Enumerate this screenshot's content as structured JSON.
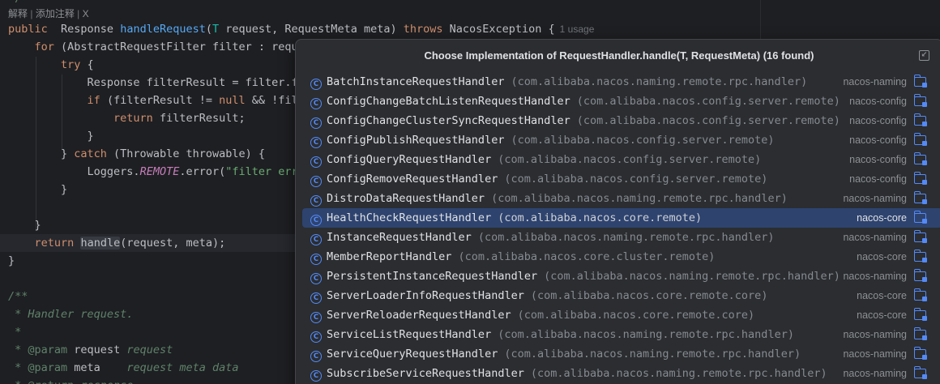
{
  "editor": {
    "hint": {
      "explain": "解释",
      "add_comment": "添加注释",
      "close": "X"
    },
    "stub": "*/",
    "usage_hint": "1 usage",
    "lines": [
      {
        "id": "l1",
        "parts": [
          [
            "kw",
            "public"
          ],
          [
            "",
            "  Response "
          ],
          [
            "fn",
            "handleRequest"
          ],
          [
            "",
            "("
          ],
          [
            "tp",
            "T"
          ],
          [
            "",
            " request, RequestMeta meta) "
          ],
          [
            "kw",
            "throws"
          ],
          [
            "",
            " NacosException {"
          ]
        ]
      },
      {
        "id": "l2",
        "parts": [
          [
            "",
            "    "
          ],
          [
            "kw",
            "for"
          ],
          [
            "",
            " (AbstractRequestFilter filter : reque"
          ]
        ]
      },
      {
        "id": "l3",
        "parts": [
          [
            "",
            "        "
          ],
          [
            "kw",
            "try"
          ],
          [
            "",
            " {"
          ]
        ]
      },
      {
        "id": "l4",
        "parts": [
          [
            "",
            "            Response filterResult = filter.fi"
          ]
        ]
      },
      {
        "id": "l5",
        "parts": [
          [
            "",
            "            "
          ],
          [
            "kw",
            "if"
          ],
          [
            "",
            " (filterResult != "
          ],
          [
            "kw",
            "null"
          ],
          [
            "",
            " && !filt"
          ]
        ]
      },
      {
        "id": "l6",
        "parts": [
          [
            "",
            "                "
          ],
          [
            "kw",
            "return"
          ],
          [
            "",
            " filterResult;"
          ]
        ]
      },
      {
        "id": "l7",
        "parts": [
          [
            "",
            "            }"
          ]
        ]
      },
      {
        "id": "l8",
        "parts": [
          [
            "",
            "        } "
          ],
          [
            "kw",
            "catch"
          ],
          [
            "",
            " (Throwable throwable) {"
          ]
        ]
      },
      {
        "id": "l9",
        "parts": [
          [
            "",
            "            Loggers."
          ],
          [
            "it",
            "REMOTE"
          ],
          [
            "",
            ".error("
          ],
          [
            "st",
            "\"filter erro"
          ]
        ]
      },
      {
        "id": "l10",
        "parts": [
          [
            "",
            "        }"
          ]
        ]
      },
      {
        "id": "l11",
        "parts": [
          [
            "",
            ""
          ]
        ]
      },
      {
        "id": "l12",
        "parts": [
          [
            "",
            "    }"
          ]
        ]
      },
      {
        "id": "l13",
        "parts": [
          [
            "",
            "    "
          ],
          [
            "kw",
            "return"
          ],
          [
            "",
            " "
          ],
          [
            "hl",
            "handle"
          ],
          [
            "",
            "(request, meta);"
          ]
        ]
      },
      {
        "id": "l14",
        "parts": [
          [
            "",
            "}"
          ]
        ]
      },
      {
        "id": "l15",
        "parts": [
          [
            "",
            ""
          ]
        ]
      },
      {
        "id": "l16",
        "parts": [
          [
            "dc",
            "/**"
          ]
        ]
      },
      {
        "id": "l17",
        "parts": [
          [
            "dc",
            " * Handler request."
          ]
        ]
      },
      {
        "id": "l18",
        "parts": [
          [
            "dc",
            " *"
          ]
        ]
      },
      {
        "id": "l19",
        "parts": [
          [
            "dc",
            " * "
          ],
          [
            "dt",
            "@param"
          ],
          [
            "",
            " request "
          ],
          [
            "dc",
            "request"
          ]
        ]
      },
      {
        "id": "l20",
        "parts": [
          [
            "dc",
            " * "
          ],
          [
            "dt",
            "@param"
          ],
          [
            "",
            " meta    "
          ],
          [
            "dc",
            "request meta data"
          ]
        ]
      },
      {
        "id": "l21",
        "parts": [
          [
            "dc",
            " * "
          ],
          [
            "dt",
            "@return"
          ],
          [
            "dc",
            " response"
          ]
        ]
      }
    ]
  },
  "popup": {
    "title": "Choose Implementation of RequestHandler.handle(T, RequestMeta) (16 found)",
    "pin_glyph": "↙",
    "class_icon_letter": "C",
    "selected_index": 7,
    "items": [
      {
        "name": "BatchInstanceRequestHandler",
        "package": "(com.alibaba.nacos.naming.remote.rpc.handler)",
        "module": "nacos-naming"
      },
      {
        "name": "ConfigChangeBatchListenRequestHandler",
        "package": "(com.alibaba.nacos.config.server.remote)",
        "module": "nacos-config"
      },
      {
        "name": "ConfigChangeClusterSyncRequestHandler",
        "package": "(com.alibaba.nacos.config.server.remote)",
        "module": "nacos-config"
      },
      {
        "name": "ConfigPublishRequestHandler",
        "package": "(com.alibaba.nacos.config.server.remote)",
        "module": "nacos-config"
      },
      {
        "name": "ConfigQueryRequestHandler",
        "package": "(com.alibaba.nacos.config.server.remote)",
        "module": "nacos-config"
      },
      {
        "name": "ConfigRemoveRequestHandler",
        "package": "(com.alibaba.nacos.config.server.remote)",
        "module": "nacos-config"
      },
      {
        "name": "DistroDataRequestHandler",
        "package": "(com.alibaba.nacos.naming.remote.rpc.handler)",
        "module": "nacos-naming"
      },
      {
        "name": "HealthCheckRequestHandler",
        "package": "(com.alibaba.nacos.core.remote)",
        "module": "nacos-core"
      },
      {
        "name": "InstanceRequestHandler",
        "package": "(com.alibaba.nacos.naming.remote.rpc.handler)",
        "module": "nacos-naming"
      },
      {
        "name": "MemberReportHandler",
        "package": "(com.alibaba.nacos.core.cluster.remote)",
        "module": "nacos-core"
      },
      {
        "name": "PersistentInstanceRequestHandler",
        "package": "(com.alibaba.nacos.naming.remote.rpc.handler)",
        "module": "nacos-naming"
      },
      {
        "name": "ServerLoaderInfoRequestHandler",
        "package": "(com.alibaba.nacos.core.remote.core)",
        "module": "nacos-core"
      },
      {
        "name": "ServerReloaderRequestHandler",
        "package": "(com.alibaba.nacos.core.remote.core)",
        "module": "nacos-core"
      },
      {
        "name": "ServiceListRequestHandler",
        "package": "(com.alibaba.nacos.naming.remote.rpc.handler)",
        "module": "nacos-naming"
      },
      {
        "name": "ServiceQueryRequestHandler",
        "package": "(com.alibaba.nacos.naming.remote.rpc.handler)",
        "module": "nacos-naming"
      },
      {
        "name": "SubscribeServiceRequestHandler",
        "package": "(com.alibaba.nacos.naming.remote.rpc.handler)",
        "module": "nacos-naming"
      }
    ]
  }
}
